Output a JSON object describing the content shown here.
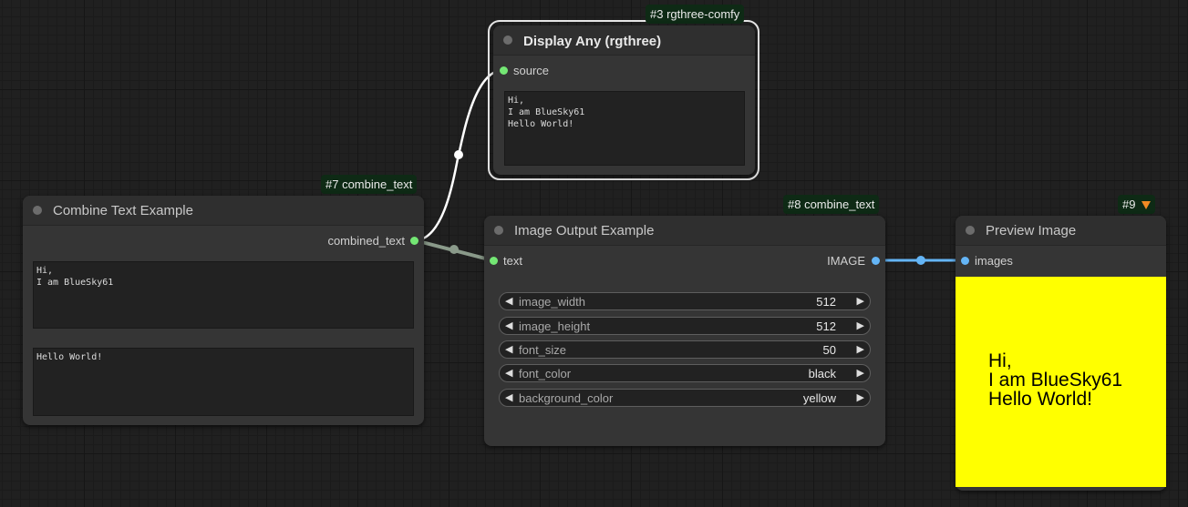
{
  "nodes": {
    "display": {
      "badge": "#3 rgthree-comfy",
      "title": "Display Any (rgthree)",
      "input_label": "source",
      "text": "Hi,\nI am BlueSky61\nHello World!"
    },
    "combine": {
      "badge": "#7 combine_text",
      "title": "Combine Text Example",
      "output_label": "combined_text",
      "text1": "Hi,\nI am BlueSky61",
      "text2": "Hello World!"
    },
    "image_output": {
      "badge": "#8 combine_text",
      "title": "Image Output Example",
      "input_label": "text",
      "output_label": "IMAGE",
      "widgets": [
        {
          "name": "image_width",
          "value": "512"
        },
        {
          "name": "image_height",
          "value": "512"
        },
        {
          "name": "font_size",
          "value": "50"
        },
        {
          "name": "font_color",
          "value": "black"
        },
        {
          "name": "background_color",
          "value": "yellow"
        }
      ]
    },
    "preview": {
      "badge": "#9",
      "badge_icon": "fox-icon",
      "title": "Preview Image",
      "input_label": "images",
      "image_lines": [
        "Hi,",
        "I am BlueSky61",
        "Hello World!"
      ],
      "image_background": "#ffff00"
    }
  },
  "colors": {
    "string_link": "#ffffff",
    "string_socket": "#74e774",
    "image_link": "#64b5f6",
    "selected_outline": "#e6e6e6"
  },
  "widget_icons": {
    "decrement": "left-arrow-icon",
    "increment": "right-arrow-icon"
  }
}
